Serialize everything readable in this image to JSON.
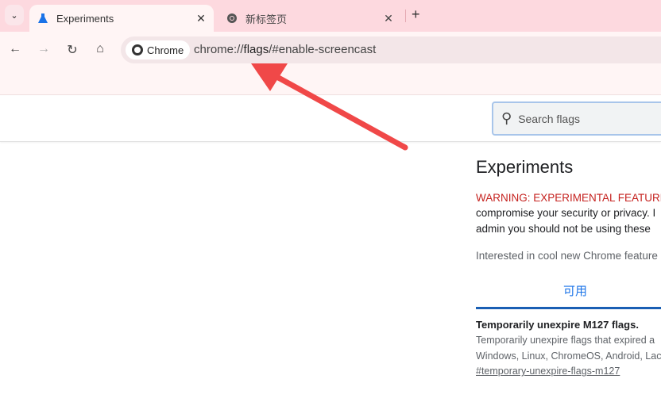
{
  "tabs": [
    {
      "title": "Experiments",
      "icon": "flask-icon",
      "active": true
    },
    {
      "title": "新标签页",
      "icon": "chrome-icon",
      "active": false
    }
  ],
  "omnibox": {
    "chip": "Chrome",
    "url_prefix": "chrome://",
    "url_host": "flags",
    "url_rest": "/#enable-screencast"
  },
  "search": {
    "placeholder": "Search flags"
  },
  "page": {
    "title": "Experiments",
    "warning": "WARNING: EXPERIMENTAL FEATURES",
    "line2": "compromise your security or privacy. I",
    "line3": "admin you should not be using these",
    "interested": "Interested in cool new Chrome feature",
    "tab_available": "可用",
    "flag": {
      "title": "Temporarily unexpire M127 flags.",
      "desc1": "Temporarily unexpire flags that expired a",
      "desc2": "Windows, Linux, ChromeOS, Android, Lac",
      "link": "#temporary-unexpire-flags-m127"
    }
  },
  "colors": {
    "annotation_arrow": "#f04848",
    "accent": "#1a73e8",
    "warning": "#c5221f"
  }
}
